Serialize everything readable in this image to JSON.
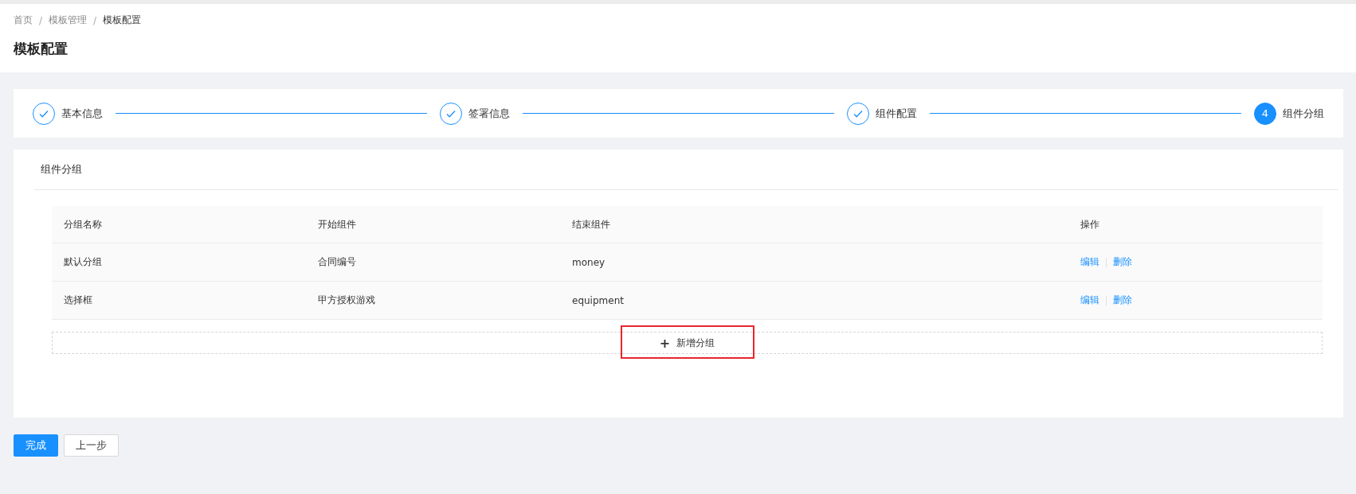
{
  "breadcrumb": [
    {
      "label": "首页",
      "current": false
    },
    {
      "label": "模板管理",
      "current": false
    },
    {
      "label": "模板配置",
      "current": true
    }
  ],
  "breadcrumb_separator": "/",
  "page_title": "模板配置",
  "steps": [
    {
      "label": "基本信息",
      "done": true,
      "current": false
    },
    {
      "label": "签署信息",
      "done": true,
      "current": false
    },
    {
      "label": "组件配置",
      "done": true,
      "current": false
    },
    {
      "label": "组件分组",
      "done": false,
      "current": true,
      "number": "4"
    }
  ],
  "section_title": "组件分组",
  "table": {
    "columns": [
      "分组名称",
      "开始组件",
      "结束组件",
      "操作"
    ],
    "rows": [
      {
        "cells": [
          "默认分组",
          "合同编号",
          "money"
        ],
        "actions": [
          "编辑",
          "删除"
        ]
      },
      {
        "cells": [
          "选择框",
          "甲方授权游戏",
          "equipment"
        ],
        "actions": [
          "编辑",
          "删除"
        ]
      }
    ]
  },
  "add_button": {
    "icon": "+",
    "label": "新增分组",
    "highlighted": true
  },
  "footer_buttons": [
    {
      "label": "完成",
      "kind": "primary"
    },
    {
      "label": "上一步",
      "kind": "default"
    }
  ]
}
